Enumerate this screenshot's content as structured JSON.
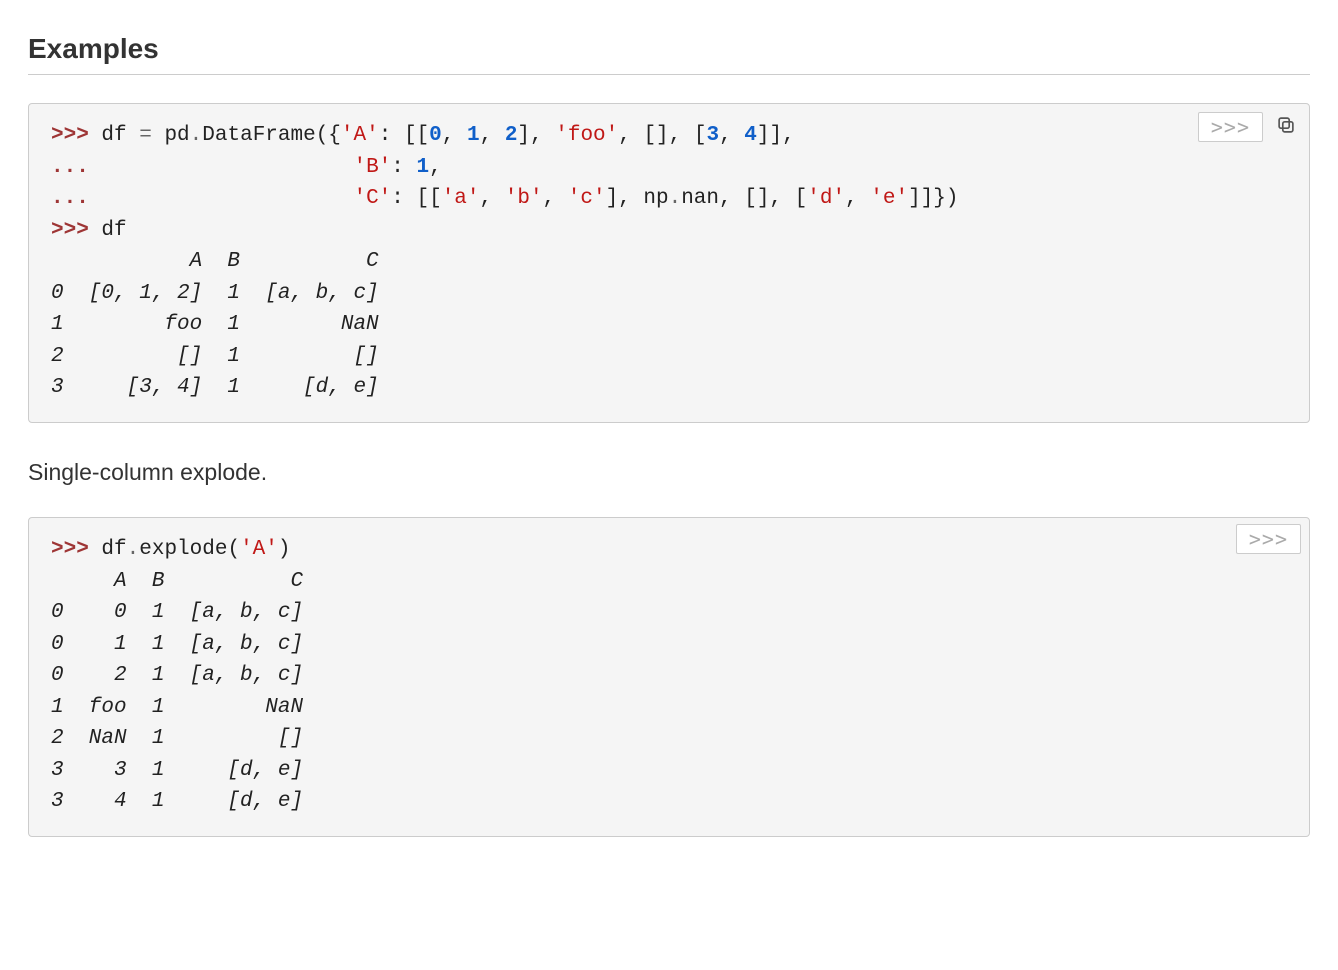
{
  "heading": "Examples",
  "toggle_label": ">>>",
  "prose1": "Single-column explode.",
  "block1": {
    "prompt1": ">>> ",
    "prompt_cont": "... ",
    "l1": {
      "a": "df ",
      "b": "= ",
      "c": "pd",
      "d": ".",
      "e": "DataFrame",
      "f": "({",
      "g": "'A'",
      "h": ": [[",
      "i0": "0",
      "j0": ", ",
      "i1": "1",
      "j1": ", ",
      "i2": "2",
      "k": "], ",
      "s_foo": "'foo'",
      "l": ", [], [",
      "i3": "3",
      "j3": ", ",
      "i4": "4",
      "m": "]],"
    },
    "l2": {
      "pad": "                    ",
      "key": "'B'",
      "sep": ": ",
      "val": "1",
      "end": ","
    },
    "l3": {
      "pad": "                    ",
      "key": "'C'",
      "sep": ": [[",
      "sa": "'a'",
      "c1": ", ",
      "sb": "'b'",
      "c2": ", ",
      "sc": "'c'",
      "mid": "], np",
      "dot": ".",
      "nan": "nan, [], [",
      "sd": "'d'",
      "c3": ", ",
      "se": "'e'",
      "end": "]]})"
    },
    "show_df": "df",
    "out": "           A  B          C\n0  [0, 1, 2]  1  [a, b, c]\n1        foo  1        NaN\n2         []  1         []\n3     [3, 4]  1     [d, e]"
  },
  "block2": {
    "prompt1": ">>> ",
    "l1": {
      "a": "df",
      "d": ".",
      "e": "explode",
      "f": "(",
      "g": "'A'",
      "h": ")"
    },
    "out": "     A  B          C\n0    0  1  [a, b, c]\n0    1  1  [a, b, c]\n0    2  1  [a, b, c]\n1  foo  1        NaN\n2  NaN  1         []\n3    3  1     [d, e]\n3    4  1     [d, e]"
  }
}
